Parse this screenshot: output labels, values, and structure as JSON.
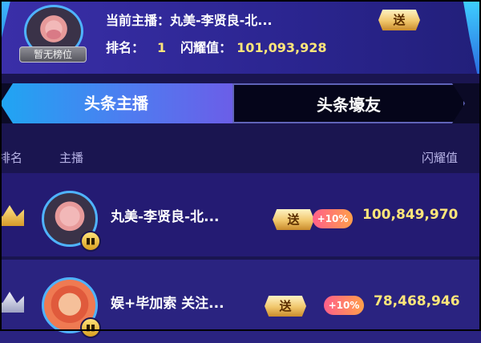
{
  "current": {
    "anchor_prefix": "当前主播：",
    "anchor_name": "丸美-李贤良-北...",
    "rank_label": "排名：",
    "rank": "1",
    "glow_label": "闪耀值：",
    "glow_value": "101,093,928",
    "status_badge": "暂无榜位",
    "send_label": "送"
  },
  "tabs": [
    {
      "label": "头条主播",
      "active": true
    },
    {
      "label": "头条壕友",
      "active": false
    }
  ],
  "columns": {
    "rank": "排名",
    "anchor": "主播",
    "value": "闪耀值"
  },
  "rows": [
    {
      "name": "丸美-李贤良-北...",
      "send_label": "送",
      "boost": "+10%",
      "value": "100,849,970",
      "crown": "gold"
    },
    {
      "name": "娱+毕加索 关注...",
      "send_label": "送",
      "boost": "+10%",
      "value": "78,468,946",
      "crown": "silver"
    }
  ],
  "colors": {
    "accent_gold": "#ffe67a",
    "tab_active": "#1fa6f3",
    "panel": "#241b73"
  }
}
